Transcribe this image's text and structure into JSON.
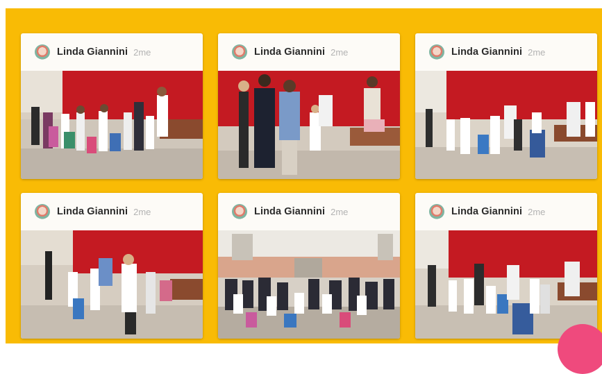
{
  "cards": [
    {
      "author": "Linda Giannini",
      "time": "2me",
      "photo": "Group of schoolchildren with backpacks lined up in front of red curtains"
    },
    {
      "author": "Linda Giannini",
      "time": "2me",
      "photo": "Teachers greeting a child near a stage with red curtains"
    },
    {
      "author": "Linda Giannini",
      "time": "2me",
      "photo": "Children with rolling backpacks in a hall with red curtains"
    },
    {
      "author": "Linda Giannini",
      "time": "2me",
      "photo": "Young pupils and teachers standing by red curtains"
    },
    {
      "author": "Linda Giannini",
      "time": "2me",
      "photo": "Families and children seated in a large hall"
    },
    {
      "author": "Linda Giannini",
      "time": "2me",
      "photo": "Children with backpacks and teachers in front of red curtains"
    }
  ],
  "colors": {
    "board": "#f9bb05",
    "curtain": "#c41a22",
    "fab": "#ef4a7d"
  }
}
